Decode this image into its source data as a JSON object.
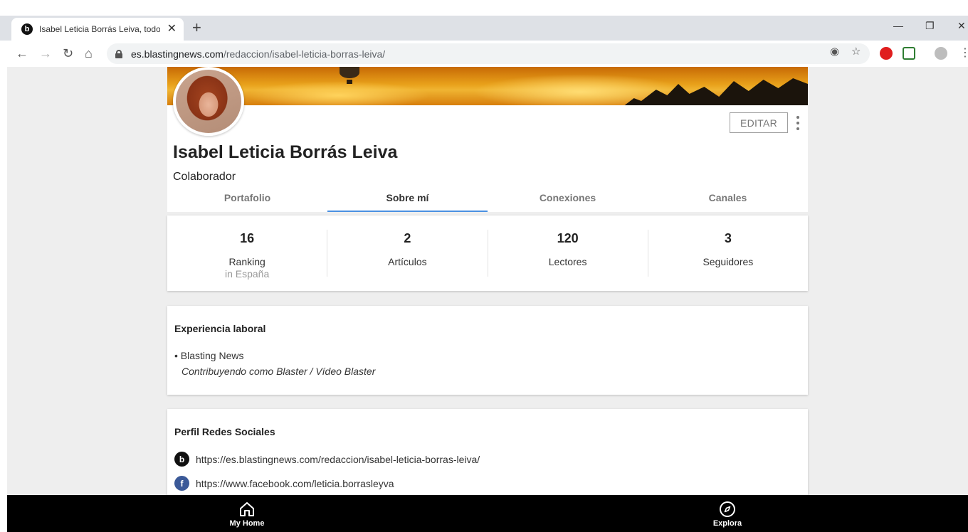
{
  "browser": {
    "tab_title": "Isabel Leticia Borrás Leiva, todos",
    "tab_favicon_letter": "b",
    "url_host": "es.blastingnews.com",
    "url_path": "/redaccion/isabel-leticia-borras-leiva/"
  },
  "profile": {
    "name": "Isabel Leticia Borrás Leiva",
    "role": "Colaborador",
    "edit_label": "EDITAR",
    "tabs": [
      {
        "label": "Portafolio",
        "active": false
      },
      {
        "label": "Sobre mí",
        "active": true
      },
      {
        "label": "Conexiones",
        "active": false
      },
      {
        "label": "Canales",
        "active": false
      }
    ]
  },
  "stats": [
    {
      "value": "16",
      "label": "Ranking",
      "sub": "in España"
    },
    {
      "value": "2",
      "label": "Artículos",
      "sub": ""
    },
    {
      "value": "120",
      "label": "Lectores",
      "sub": ""
    },
    {
      "value": "3",
      "label": "Seguidores",
      "sub": ""
    }
  ],
  "experience": {
    "title": "Experiencia laboral",
    "company": "• Blasting News",
    "position": "Contribuyendo como Blaster / Vídeo Blaster"
  },
  "social": {
    "title": "Perfil Redes Sociales",
    "links": [
      {
        "icon": "blastingnews-icon",
        "letter": "b",
        "color": "#111111",
        "url": "https://es.blastingnews.com/redaccion/isabel-leticia-borras-leiva/"
      },
      {
        "icon": "facebook-icon",
        "letter": "f",
        "color": "#3b5998",
        "url": "https://www.facebook.com/leticia.borrasleyva"
      }
    ]
  },
  "bottom_nav": {
    "home_label": "My Home",
    "explore_label": "Explora"
  },
  "colors": {
    "accent": "#4a90e2",
    "page_bg": "#eeeeee"
  }
}
